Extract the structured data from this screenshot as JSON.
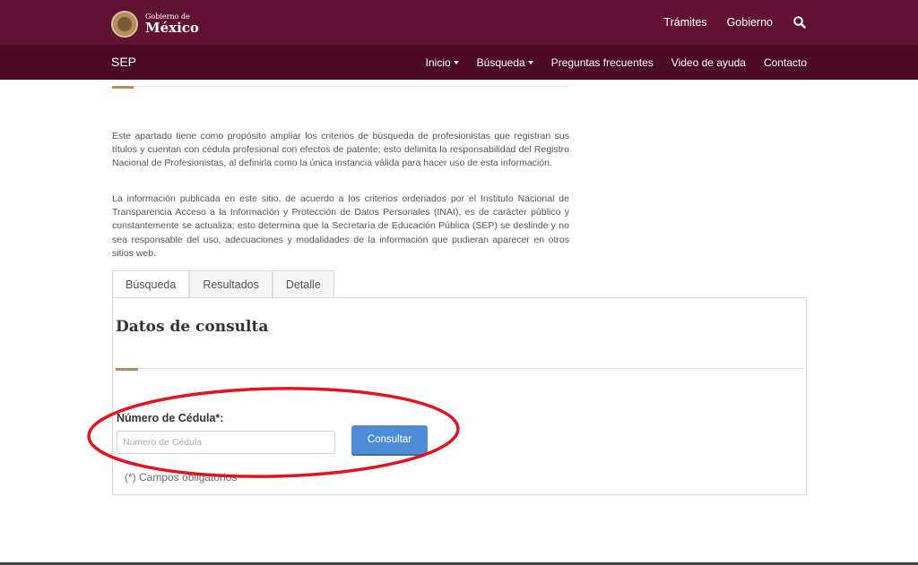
{
  "header": {
    "logo": {
      "small": "Gobierno de",
      "big": "México"
    },
    "links": [
      "Trámites",
      "Gobierno"
    ],
    "search_icon": "search-icon"
  },
  "navbar": {
    "brand": "SEP",
    "items": [
      {
        "label": "Inicio",
        "dropdown": true
      },
      {
        "label": "Búsqueda",
        "dropdown": true
      },
      {
        "label": "Preguntas frecuentes",
        "dropdown": false
      },
      {
        "label": "Video de ayuda",
        "dropdown": false
      },
      {
        "label": "Contacto",
        "dropdown": false
      }
    ]
  },
  "intro": {
    "p1": "Este apartado tiene como propósito ampliar los criterios de búsqueda de profesionistas que registran sus títulos y cuentan con cédula profesional con efectos de patente; esto delimita la responsabilidad del Registro Nacional de Profesionistas, al definirla como la única instancia válida para hacer uso de esta información.",
    "p2": "La información publicada en este sitio, de acuerdo a los criterios ordenados por el Instituto Nacional de Transparencia  Acceso a la Información y Protección de Datos Personales (INAI), es de carácter público y constantemente se actualiza; esto determina que la Secretaría de Educación Pública (SEP) se deslinde y no sea responsable del uso, adecuaciones y modalidades de la información que pudieran aparecer en otros sitios web."
  },
  "tabs": [
    "Búsqueda",
    "Resultados",
    "Detalle"
  ],
  "form": {
    "title": "Datos de consulta",
    "cedula_label": "Número de Cédula*:",
    "cedula_placeholder": "Número de Cédula",
    "cedula_value": "",
    "submit_label": "Consultar",
    "required_note": "(*) Campos obligatorios"
  },
  "colors": {
    "topbar": "#611232",
    "navbar": "#4d0a24",
    "accent": "#b38e5d",
    "button": "#4e8cd7",
    "annotation": "#e3141e"
  }
}
